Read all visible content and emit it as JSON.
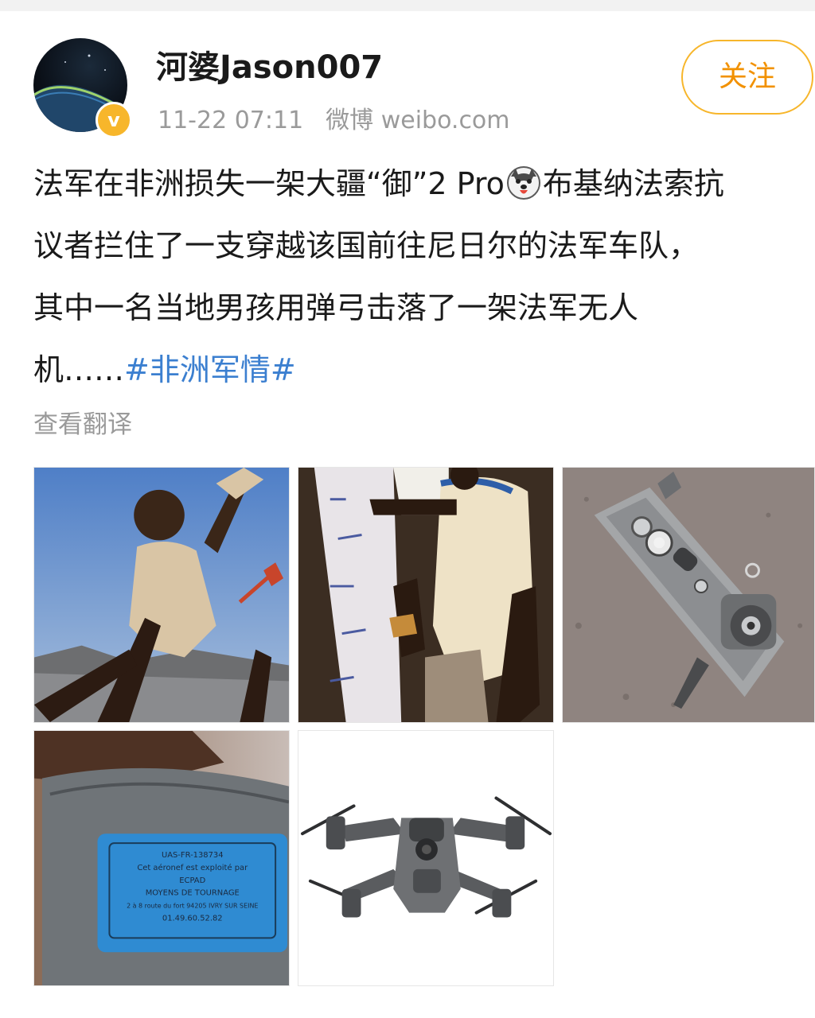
{
  "user": {
    "name": "河婆Jason007",
    "verified_badge": "v"
  },
  "post": {
    "time": "11-22 07:11",
    "source": "微博 weibo.com",
    "follow_label": "关注",
    "text_lines": [
      "法军在非洲损失一架大疆“御”2 Pro",
      "布基纳法索抗",
      "议者拦住了一支穿越该国前往尼日尔的法军车队，",
      "其中一名当地男孩用弹弓击落了一架法军无人",
      "机……"
    ],
    "hashtag": "#非洲军情#",
    "emoji": "dog-face-emoji",
    "translate_label": "查看翻译"
  },
  "images": [
    {
      "name": "boy-with-slingshot-photo"
    },
    {
      "name": "boy-holding-slingshot-crowd-photo"
    },
    {
      "name": "downed-drone-on-ground-photo"
    },
    {
      "name": "drone-label-closeup-photo",
      "label_lines": [
        "UAS-FR-138734",
        "Cet aéronef est exploité par",
        "ECPAD",
        "MOYENS DE TOURNAGE",
        "2 à 8 route du fort 94205 IVRY SUR SEINE",
        "01.49.60.52.82"
      ]
    },
    {
      "name": "dji-mavic-2-product-photo"
    }
  ],
  "colors": {
    "accent_orange": "#f29100",
    "follow_border": "#f7b62b",
    "hashtag_blue": "#3b7fd0",
    "meta_gray": "#9a9a9a"
  }
}
